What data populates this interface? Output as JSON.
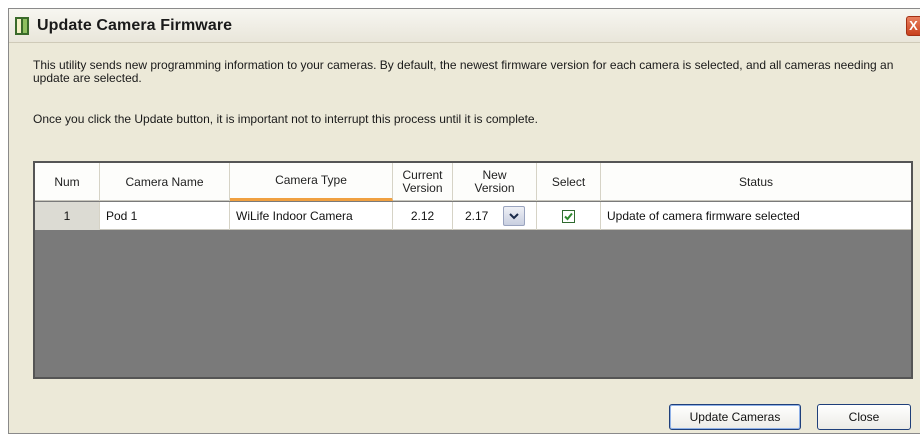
{
  "window": {
    "title": "Update Camera Firmware",
    "close_glyph": "X"
  },
  "description": {
    "line1": "This utility sends new programming information to your cameras.  By default, the newest firmware version for each camera is selected, and all cameras needing an update are selected.",
    "line2": "Once you click the Update button, it is important not to interrupt this process until it is complete."
  },
  "grid": {
    "columns": {
      "num": "Num",
      "camera_name": "Camera Name",
      "camera_type": "Camera Type",
      "current_version_1": "Current",
      "current_version_2": "Version",
      "new_version_1": "New",
      "new_version_2": "Version",
      "select": "Select",
      "status": "Status"
    },
    "rows": [
      {
        "num": "1",
        "camera_name": "Pod 1",
        "camera_type": "WiLife Indoor Camera",
        "current_version": "2.12",
        "new_version": "2.17",
        "selected": true,
        "status": "Update of camera firmware selected"
      }
    ]
  },
  "buttons": {
    "update": "Update Cameras",
    "close": "Close"
  },
  "icons": {
    "app": "camera-firmware-icon",
    "dropdown": "chevron-down-icon",
    "check": "checkmark-icon"
  },
  "colors": {
    "sort_indicator": "#f0a040",
    "grid_background": "#7a7a7a",
    "check_green": "#2f8a2f"
  }
}
